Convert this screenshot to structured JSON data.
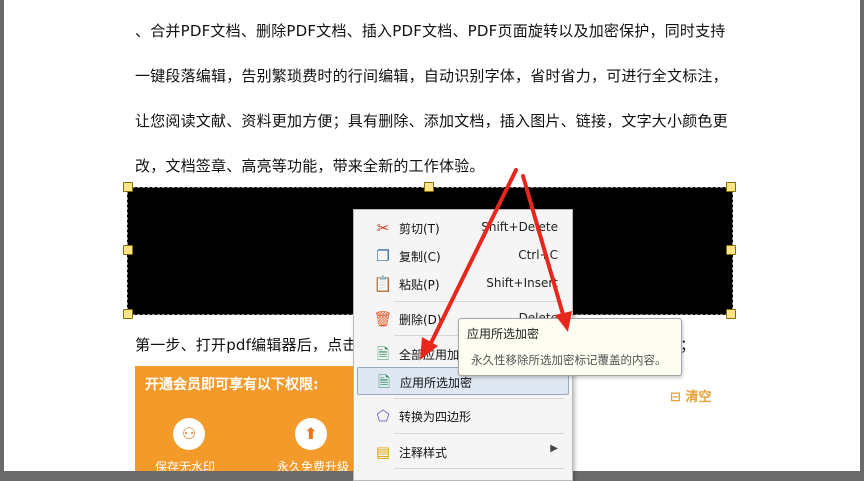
{
  "document": {
    "lines": [
      "、合并PDF文档、删除PDF文档、插入PDF文档、PDF页面旋转以及加密保护，同时支持",
      "一键段落编辑，告别繁琐费时的行间编辑，自动识别字体，省时省力，可进行全文标注，",
      "让您阅读文献、资料更加方便；具有删除、添加文档，插入图片、链接，文字大小颜色更",
      "改，文档签章、高亮等功能，带来全新的工作体验。"
    ],
    "step_line": "第一步、打开pdf编辑器后，点击",
    "step_tail": "；"
  },
  "promo": {
    "header": "开通会员即可享有以下权限:",
    "item1_label": "保存无水印",
    "item2_label": "永久免费升级"
  },
  "clear_label": "清空",
  "context_menu": {
    "items": [
      {
        "label": "剪切(T)",
        "shortcut": "Shift+Delete",
        "icon": "scissors-icon"
      },
      {
        "label": "复制(C)",
        "shortcut": "Ctrl+C",
        "icon": "copy-icon"
      },
      {
        "label": "粘贴(P)",
        "shortcut": "Shift+Insert",
        "icon": "paste-icon"
      },
      {
        "label": "删除(D)",
        "shortcut": "Delete",
        "icon": "trash-icon"
      },
      {
        "label": "全部应用加密",
        "shortcut": "",
        "icon": "apply-all-redaction-icon"
      },
      {
        "label": "应用所选加密",
        "shortcut": "",
        "icon": "apply-selected-redaction-icon"
      },
      {
        "label": "转换为四边形",
        "shortcut": "",
        "icon": "quad-icon"
      },
      {
        "label": "注释样式",
        "shortcut": "",
        "icon": "annotation-style-icon"
      }
    ]
  },
  "tooltip": {
    "title": "应用所选加密",
    "description": "永久性移除所选加密标记覆盖的内容。"
  },
  "colors": {
    "accent_arrow": "#e8271c",
    "redaction": "#000000",
    "promo": "#f39a2b"
  }
}
